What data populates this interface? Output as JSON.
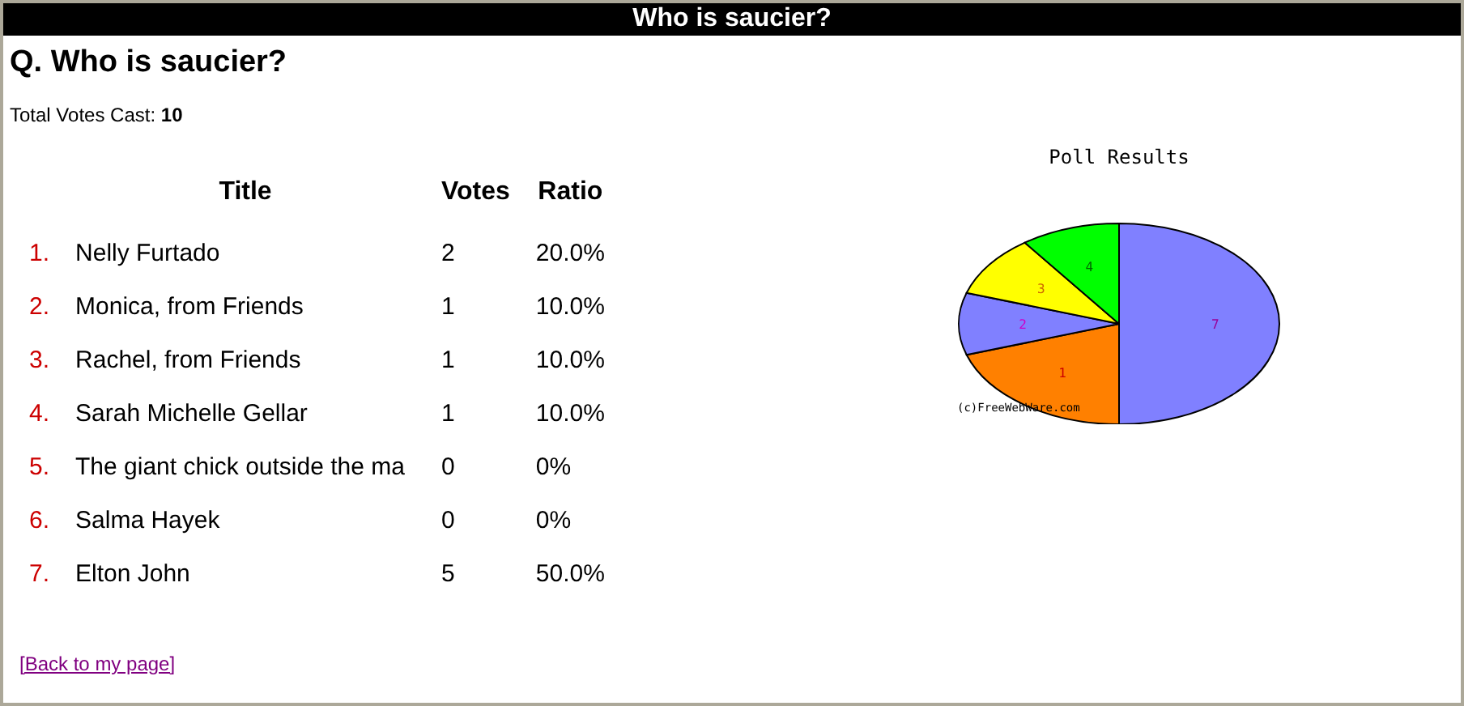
{
  "window": {
    "title": "Who is saucier?"
  },
  "question": "Q. Who is saucier?",
  "total": {
    "label": "Total Votes Cast:",
    "value": "10"
  },
  "table": {
    "columns": [
      "Title",
      "Votes",
      "Ratio"
    ],
    "rows": [
      {
        "number": "1.",
        "title": "Nelly Furtado",
        "votes": "2",
        "ratio": "20.0%"
      },
      {
        "number": "2.",
        "title": "Monica, from Friends",
        "votes": "1",
        "ratio": "10.0%"
      },
      {
        "number": "3.",
        "title": "Rachel, from Friends",
        "votes": "1",
        "ratio": "10.0%"
      },
      {
        "number": "4.",
        "title": "Sarah Michelle Gellar",
        "votes": "1",
        "ratio": "10.0%"
      },
      {
        "number": "5.",
        "title": "The giant chick outside the ma",
        "votes": "0",
        "ratio": "0%"
      },
      {
        "number": "6.",
        "title": "Salma Hayek",
        "votes": "0",
        "ratio": "0%"
      },
      {
        "number": "7.",
        "title": "Elton John",
        "votes": "5",
        "ratio": "50.0%"
      }
    ]
  },
  "chart": {
    "title": "Poll Results",
    "slice_labels": [
      "1",
      "2",
      "3",
      "4",
      "7"
    ],
    "credit": "(c)FreeWebWare.com"
  },
  "back_link": "[Back to my page]"
}
